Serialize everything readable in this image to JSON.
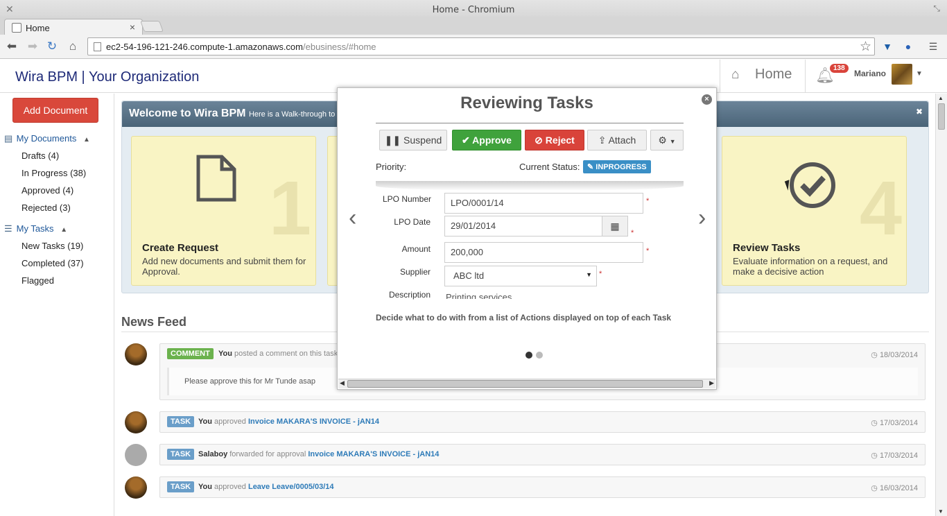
{
  "browser": {
    "window_title": "Home - Chromium",
    "tab_title": "Home",
    "url_host": "ec2-54-196-121-246.compute-1.amazonaws.com",
    "url_path": "/ebusiness/#home"
  },
  "header": {
    "brand": "Wira BPM | Your Organization",
    "home_label": "Home",
    "notification_count": "138",
    "user_name": "Mariano"
  },
  "sidebar": {
    "add_button": "Add Document",
    "my_documents": "My Documents",
    "documents": [
      {
        "label": "Drafts (4)"
      },
      {
        "label": "In Progress (38)"
      },
      {
        "label": "Approved (4)"
      },
      {
        "label": "Rejected (3)"
      }
    ],
    "my_tasks": "My Tasks",
    "tasks": [
      {
        "label": "New Tasks (19)"
      },
      {
        "label": "Completed (37)"
      },
      {
        "label": "Flagged"
      }
    ]
  },
  "welcome": {
    "title": "Welcome to Wira BPM",
    "subtitle": "Here is a Walk-through to g",
    "cards": [
      {
        "num": "1",
        "title": "Create Request",
        "desc": "Add new documents and submit them for Approval.",
        "icon": "file-icon"
      },
      {
        "num": "4",
        "title": "Review Tasks",
        "desc": "Evaluate information on a request, and make a decisive action",
        "icon": "check-circle-icon"
      }
    ]
  },
  "news_feed": {
    "title": "News Feed",
    "items": [
      {
        "label": "COMMENT",
        "actor": "You",
        "text": "posted a comment on this task",
        "link": "",
        "date": "18/03/2014",
        "comment": "Please approve this for Mr Tunde asap"
      },
      {
        "label": "TASK",
        "actor": "You",
        "text": "approved",
        "link": "Invoice MAKARA'S INVOICE - jAN14",
        "date": "17/03/2014"
      },
      {
        "label": "TASK",
        "actor": "Salaboy",
        "text": "forwarded for approval",
        "link": "Invoice MAKARA'S INVOICE - jAN14",
        "date": "17/03/2014"
      },
      {
        "label": "TASK",
        "actor": "You",
        "text": "approved",
        "link": "Leave Leave/0005/03/14",
        "date": "16/03/2014"
      }
    ]
  },
  "modal": {
    "title": "Reviewing Tasks",
    "actions": {
      "suspend": "Suspend",
      "approve": "Approve",
      "reject": "Reject",
      "attach": "Attach"
    },
    "priority_label": "Priority:",
    "status_label": "Current Status:",
    "status_value": "INPROGRESS",
    "fields": {
      "lpo_number_label": "LPO Number",
      "lpo_number": "LPO/0001/14",
      "lpo_date_label": "LPO Date",
      "lpo_date": "29/01/2014",
      "amount_label": "Amount",
      "amount": "200,000",
      "supplier_label": "Supplier",
      "supplier": "ABC ltd",
      "description_label": "Description",
      "description": "Printing services"
    },
    "hint": "Decide what to do with from a list of Actions displayed on top of each Task",
    "slides": 2,
    "active_slide": 1
  },
  "colors": {
    "brand": "#1e2a78",
    "add_button": "#d9483b",
    "approve": "#3fa23c",
    "reject": "#d9433a",
    "status": "#3a8fc6",
    "card_bg": "#f9f4c4"
  }
}
